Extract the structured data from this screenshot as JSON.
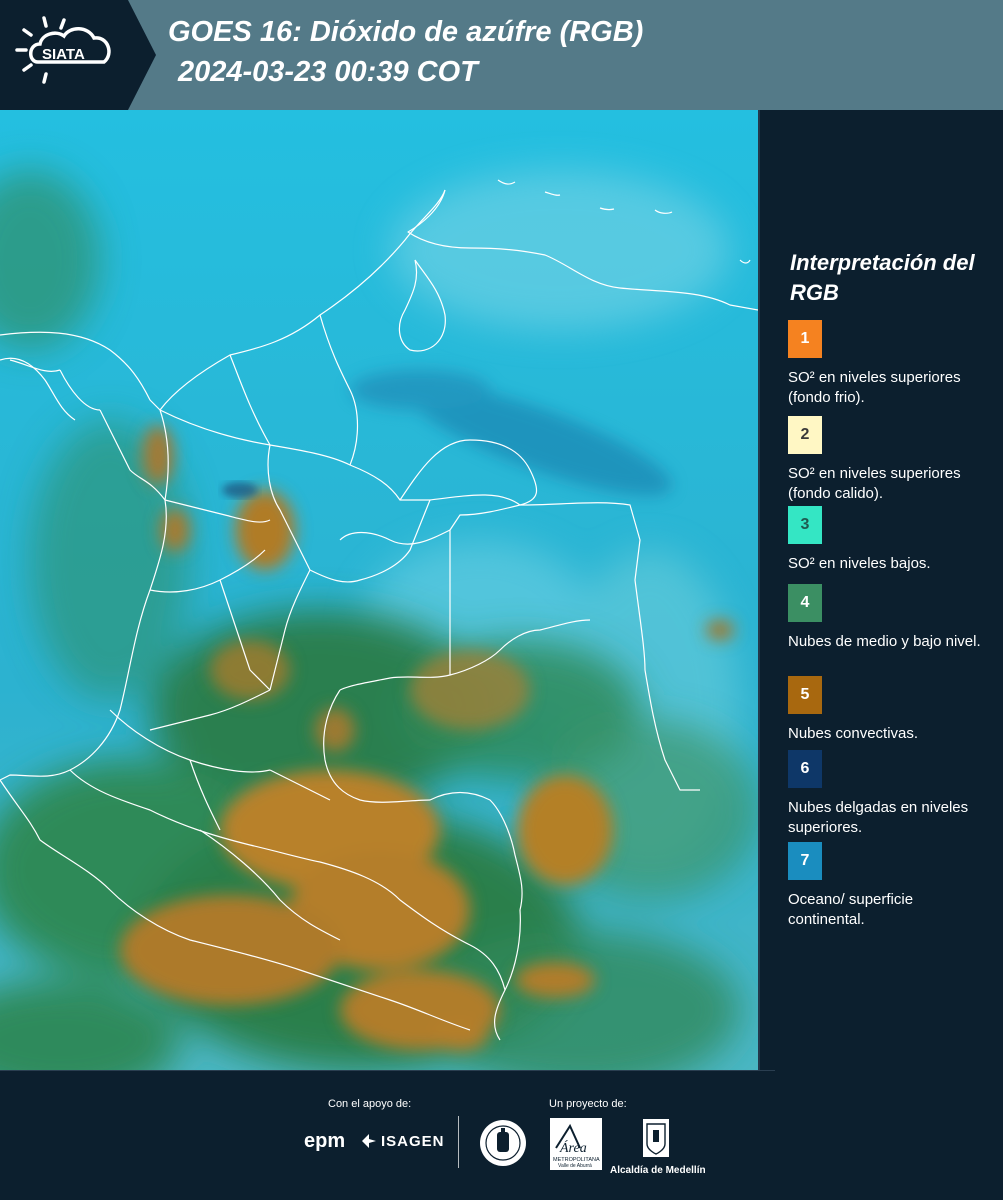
{
  "header": {
    "logo_text": "SIATA",
    "title_line1": "GOES 16: Dióxido de azúfre (RGB)",
    "title_line2": "2024-03-23 00:39 COT",
    "background_color": "#547a88"
  },
  "legend": {
    "title": "Interpretación del RGB",
    "items": [
      {
        "number": "1",
        "color": "#f58220",
        "text": "SO² en niveles superiores (fondo frio)."
      },
      {
        "number": "2",
        "color": "#fff7c4",
        "text": "SO² en niveles superiores (fondo calido)."
      },
      {
        "number": "3",
        "color": "#34e6c4",
        "text": "SO² en niveles bajos."
      },
      {
        "number": "4",
        "color": "#3b8f63",
        "text": "Nubes de medio y bajo nivel."
      },
      {
        "number": "5",
        "color": "#a8680f",
        "text": "Nubes convectivas."
      },
      {
        "number": "6",
        "color": "#0e3768",
        "text": "Nubes delgadas en niveles superiores."
      },
      {
        "number": "7",
        "color": "#1a8dbf",
        "text": "Oceano/ superficie continental."
      }
    ]
  },
  "footer": {
    "support_label": "Con el apoyo de:",
    "project_label": "Un proyecto de:",
    "sponsors": [
      "epm",
      "ISAGEN"
    ],
    "partners": [
      "Medellín",
      "Área Metropolitana Valle de Aburrá",
      "Alcaldía de Medellín"
    ],
    "epm_text": "epm",
    "isagen_text": "ISAGEN",
    "area_text": "Área",
    "area_sub": "METROPOLITANA",
    "area_sub2": "Valle de Aburrá",
    "alcaldia_text": "Alcaldía de Medellín"
  },
  "map": {
    "colors": {
      "ocean": "#22b8da",
      "cloud_green": "#2a7a4a",
      "cloud_orange": "#b88028",
      "border": "#ffffff"
    }
  }
}
